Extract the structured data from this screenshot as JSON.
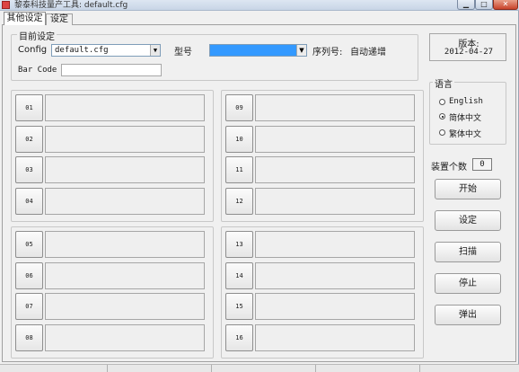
{
  "window": {
    "title": "黎泰科技量产工具: default.cfg",
    "controls": {
      "minimize": "▁",
      "maximize": "□",
      "close": "✕"
    }
  },
  "tabs": [
    {
      "label": "其他设定",
      "active": true
    },
    {
      "label": "设定",
      "active": false
    }
  ],
  "current_settings": {
    "legend": "目前设定",
    "config_label": "Config",
    "config_value": "default.cfg",
    "model_label": "型号",
    "model_value": "",
    "serial_label": "序列号:",
    "serial_value": "自动递增",
    "barcode_label": "Bar Code",
    "barcode_value": ""
  },
  "slots": [
    {
      "num": "01"
    },
    {
      "num": "02"
    },
    {
      "num": "03"
    },
    {
      "num": "04"
    },
    {
      "num": "05"
    },
    {
      "num": "06"
    },
    {
      "num": "07"
    },
    {
      "num": "08"
    },
    {
      "num": "09"
    },
    {
      "num": "10"
    },
    {
      "num": "11"
    },
    {
      "num": "12"
    },
    {
      "num": "13"
    },
    {
      "num": "14"
    },
    {
      "num": "15"
    },
    {
      "num": "16"
    }
  ],
  "version": {
    "label": "版本:",
    "date": "2012-04-27"
  },
  "language": {
    "legend": "语言",
    "options": [
      {
        "label": "English",
        "checked": false
      },
      {
        "label": "简体中文",
        "checked": true
      },
      {
        "label": "繁体中文",
        "checked": false
      }
    ]
  },
  "device_count": {
    "label": "装置个数",
    "value": "0"
  },
  "buttons": {
    "start": "开始",
    "settings": "设定",
    "scan": "扫描",
    "stop": "停止",
    "eject": "弹出"
  },
  "colors": {
    "selection": "#3399ff",
    "panel": "#f0f0f0"
  }
}
